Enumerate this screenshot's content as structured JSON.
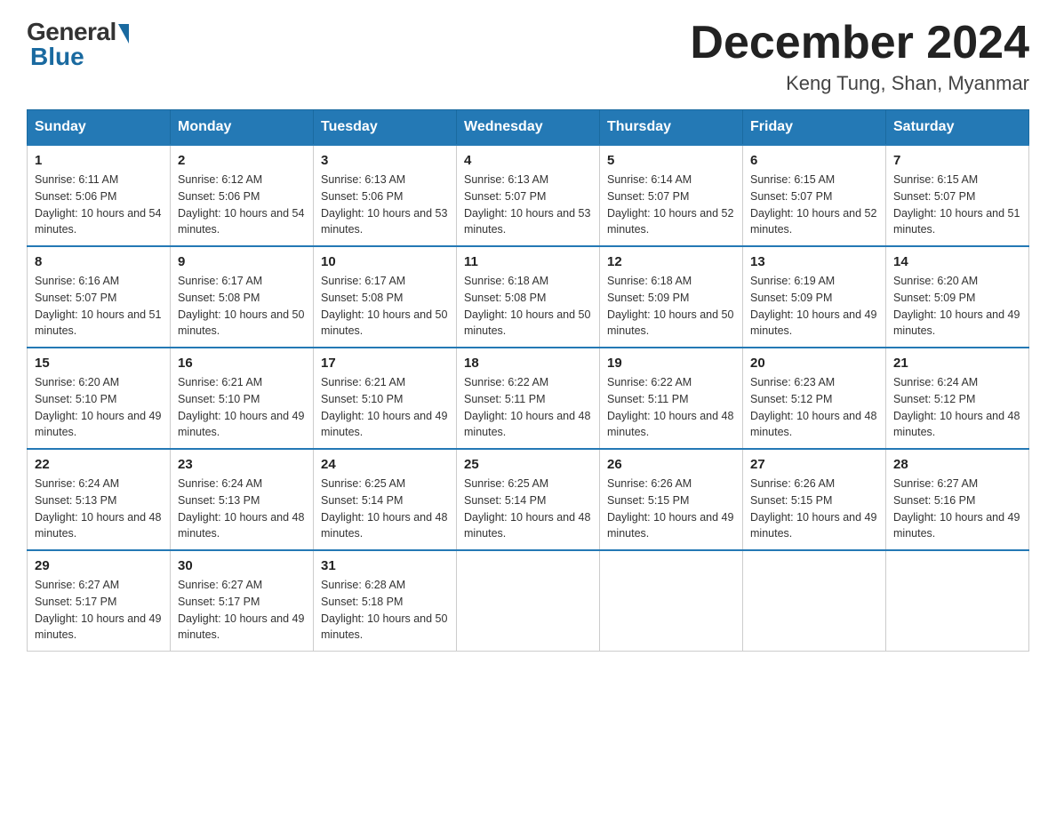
{
  "logo": {
    "general": "General",
    "blue": "Blue"
  },
  "title": "December 2024",
  "location": "Keng Tung, Shan, Myanmar",
  "days_of_week": [
    "Sunday",
    "Monday",
    "Tuesday",
    "Wednesday",
    "Thursday",
    "Friday",
    "Saturday"
  ],
  "weeks": [
    [
      {
        "day": "1",
        "sunrise": "6:11 AM",
        "sunset": "5:06 PM",
        "daylight": "10 hours and 54 minutes."
      },
      {
        "day": "2",
        "sunrise": "6:12 AM",
        "sunset": "5:06 PM",
        "daylight": "10 hours and 54 minutes."
      },
      {
        "day": "3",
        "sunrise": "6:13 AM",
        "sunset": "5:06 PM",
        "daylight": "10 hours and 53 minutes."
      },
      {
        "day": "4",
        "sunrise": "6:13 AM",
        "sunset": "5:07 PM",
        "daylight": "10 hours and 53 minutes."
      },
      {
        "day": "5",
        "sunrise": "6:14 AM",
        "sunset": "5:07 PM",
        "daylight": "10 hours and 52 minutes."
      },
      {
        "day": "6",
        "sunrise": "6:15 AM",
        "sunset": "5:07 PM",
        "daylight": "10 hours and 52 minutes."
      },
      {
        "day": "7",
        "sunrise": "6:15 AM",
        "sunset": "5:07 PM",
        "daylight": "10 hours and 51 minutes."
      }
    ],
    [
      {
        "day": "8",
        "sunrise": "6:16 AM",
        "sunset": "5:07 PM",
        "daylight": "10 hours and 51 minutes."
      },
      {
        "day": "9",
        "sunrise": "6:17 AM",
        "sunset": "5:08 PM",
        "daylight": "10 hours and 50 minutes."
      },
      {
        "day": "10",
        "sunrise": "6:17 AM",
        "sunset": "5:08 PM",
        "daylight": "10 hours and 50 minutes."
      },
      {
        "day": "11",
        "sunrise": "6:18 AM",
        "sunset": "5:08 PM",
        "daylight": "10 hours and 50 minutes."
      },
      {
        "day": "12",
        "sunrise": "6:18 AM",
        "sunset": "5:09 PM",
        "daylight": "10 hours and 50 minutes."
      },
      {
        "day": "13",
        "sunrise": "6:19 AM",
        "sunset": "5:09 PM",
        "daylight": "10 hours and 49 minutes."
      },
      {
        "day": "14",
        "sunrise": "6:20 AM",
        "sunset": "5:09 PM",
        "daylight": "10 hours and 49 minutes."
      }
    ],
    [
      {
        "day": "15",
        "sunrise": "6:20 AM",
        "sunset": "5:10 PM",
        "daylight": "10 hours and 49 minutes."
      },
      {
        "day": "16",
        "sunrise": "6:21 AM",
        "sunset": "5:10 PM",
        "daylight": "10 hours and 49 minutes."
      },
      {
        "day": "17",
        "sunrise": "6:21 AM",
        "sunset": "5:10 PM",
        "daylight": "10 hours and 49 minutes."
      },
      {
        "day": "18",
        "sunrise": "6:22 AM",
        "sunset": "5:11 PM",
        "daylight": "10 hours and 48 minutes."
      },
      {
        "day": "19",
        "sunrise": "6:22 AM",
        "sunset": "5:11 PM",
        "daylight": "10 hours and 48 minutes."
      },
      {
        "day": "20",
        "sunrise": "6:23 AM",
        "sunset": "5:12 PM",
        "daylight": "10 hours and 48 minutes."
      },
      {
        "day": "21",
        "sunrise": "6:24 AM",
        "sunset": "5:12 PM",
        "daylight": "10 hours and 48 minutes."
      }
    ],
    [
      {
        "day": "22",
        "sunrise": "6:24 AM",
        "sunset": "5:13 PM",
        "daylight": "10 hours and 48 minutes."
      },
      {
        "day": "23",
        "sunrise": "6:24 AM",
        "sunset": "5:13 PM",
        "daylight": "10 hours and 48 minutes."
      },
      {
        "day": "24",
        "sunrise": "6:25 AM",
        "sunset": "5:14 PM",
        "daylight": "10 hours and 48 minutes."
      },
      {
        "day": "25",
        "sunrise": "6:25 AM",
        "sunset": "5:14 PM",
        "daylight": "10 hours and 48 minutes."
      },
      {
        "day": "26",
        "sunrise": "6:26 AM",
        "sunset": "5:15 PM",
        "daylight": "10 hours and 49 minutes."
      },
      {
        "day": "27",
        "sunrise": "6:26 AM",
        "sunset": "5:15 PM",
        "daylight": "10 hours and 49 minutes."
      },
      {
        "day": "28",
        "sunrise": "6:27 AM",
        "sunset": "5:16 PM",
        "daylight": "10 hours and 49 minutes."
      }
    ],
    [
      {
        "day": "29",
        "sunrise": "6:27 AM",
        "sunset": "5:17 PM",
        "daylight": "10 hours and 49 minutes."
      },
      {
        "day": "30",
        "sunrise": "6:27 AM",
        "sunset": "5:17 PM",
        "daylight": "10 hours and 49 minutes."
      },
      {
        "day": "31",
        "sunrise": "6:28 AM",
        "sunset": "5:18 PM",
        "daylight": "10 hours and 50 minutes."
      },
      null,
      null,
      null,
      null
    ]
  ],
  "labels": {
    "sunrise_prefix": "Sunrise: ",
    "sunset_prefix": "Sunset: ",
    "daylight_prefix": "Daylight: "
  }
}
